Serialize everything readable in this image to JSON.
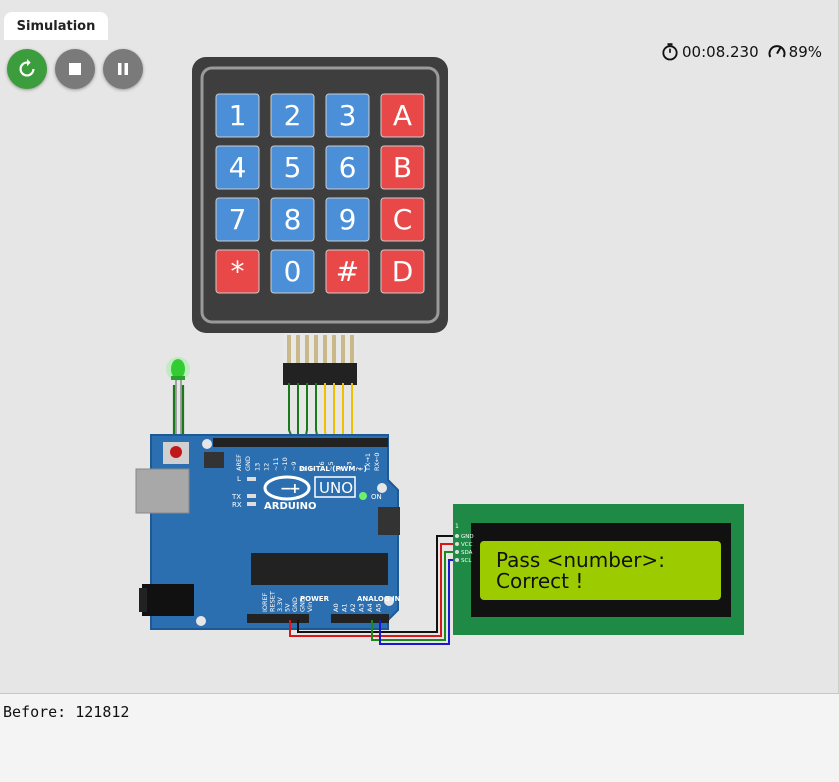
{
  "tab": {
    "label": "Simulation"
  },
  "controls": {
    "restart_icon": "restart-icon",
    "stop_icon": "stop-icon",
    "pause_icon": "pause-icon"
  },
  "status": {
    "timer": "00:08.230",
    "speed": "89%"
  },
  "keypad": {
    "rows": [
      [
        "1",
        "2",
        "3",
        "A"
      ],
      [
        "4",
        "5",
        "6",
        "B"
      ],
      [
        "7",
        "8",
        "9",
        "C"
      ],
      [
        "*",
        "0",
        "#",
        "D"
      ]
    ],
    "colors": {
      "digit": "#4a8fd8",
      "symbol": "#e84848",
      "frame": "#3e3e3e"
    }
  },
  "arduino": {
    "model": "UNO",
    "brand": "ARDUINO",
    "digital_label": "DIGITAL (PWM ~)",
    "analog_label": "ANALOG IN",
    "power_label": "POWER",
    "on_label": "ON",
    "tx_label": "TX",
    "rx_label": "RX",
    "l_label": "L",
    "digital_pins": [
      "AREF",
      "GND",
      "13",
      "12",
      "~11",
      "~10",
      "~9",
      "8",
      "7",
      "~6",
      "~5",
      "4",
      "~3",
      "2",
      "TX→1",
      "RX←0"
    ],
    "power_pins": [
      "IOREF",
      "RESET",
      "3.3V",
      "5V",
      "GND",
      "GND",
      "Vin"
    ],
    "analog_pins": [
      "A0",
      "A1",
      "A2",
      "A3",
      "A4",
      "A5"
    ],
    "color": "#2b6fb0"
  },
  "lcd": {
    "line1": "Pass <number>:",
    "line2": "Correct !",
    "pins": [
      "GND",
      "VCC",
      "SDA",
      "SCL"
    ],
    "pin_one": "1",
    "board_color": "#1f8a45",
    "screen_color": "#9ccc00"
  },
  "led": {
    "color": "#33cc33",
    "state": "on"
  },
  "console": {
    "text": "Before: 121812"
  }
}
